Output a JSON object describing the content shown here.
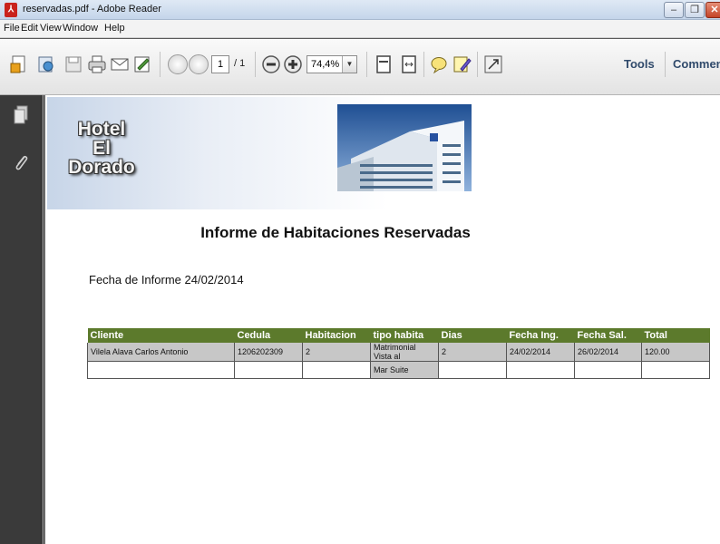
{
  "window": {
    "title": "reservadas.pdf - Adobe Reader",
    "minimize": "–",
    "maximize": "❐",
    "close": "✕"
  },
  "menu": [
    {
      "label": "File"
    },
    {
      "label": "Edit"
    },
    {
      "label": "View"
    },
    {
      "label": "Window"
    },
    {
      "label": "Help"
    }
  ],
  "toolbar": {
    "page_current": "1",
    "page_total": "/ 1",
    "zoom": "74,4%",
    "tools_label": "Tools",
    "comment_label": "Comment"
  },
  "document": {
    "hotel_name_line1": "Hotel",
    "hotel_name_line2": "El Dorado",
    "report_title": "Informe de Habitaciones Reservadas",
    "report_date": "Fecha de Informe 24/02/2014",
    "table": {
      "headers": [
        "Cliente",
        "Cedula",
        "Habitacion",
        "tipo habita",
        "Dias",
        "Fecha Ing.",
        "Fecha Sal.",
        "Total"
      ],
      "rows": [
        {
          "cliente": "Vilela Alava Carlos Antonio",
          "cedula": "1206202309",
          "habitacion": "2",
          "tipo_line1": "Matrimonial Vista al",
          "tipo_line2": "Mar Suite",
          "dias": "2",
          "fecha_ing": "24/02/2014",
          "fecha_sal": "26/02/2014",
          "total": "120.00"
        }
      ]
    }
  },
  "colors": {
    "table_header": "#5c7a2c",
    "row_grey": "#c7c7c7",
    "nav_panel": "#3a3a3a"
  },
  "icons": [
    "pdf-app-icon",
    "create-icon",
    "open-icon",
    "save-icon",
    "print-icon",
    "email-icon",
    "sign-icon",
    "prev-page-icon",
    "next-page-icon",
    "zoom-out-icon",
    "zoom-in-icon",
    "fit-page-icon",
    "fit-width-icon",
    "comment-icon",
    "highlight-icon",
    "fullscreen-icon",
    "pages-panel-icon",
    "attachments-icon"
  ]
}
